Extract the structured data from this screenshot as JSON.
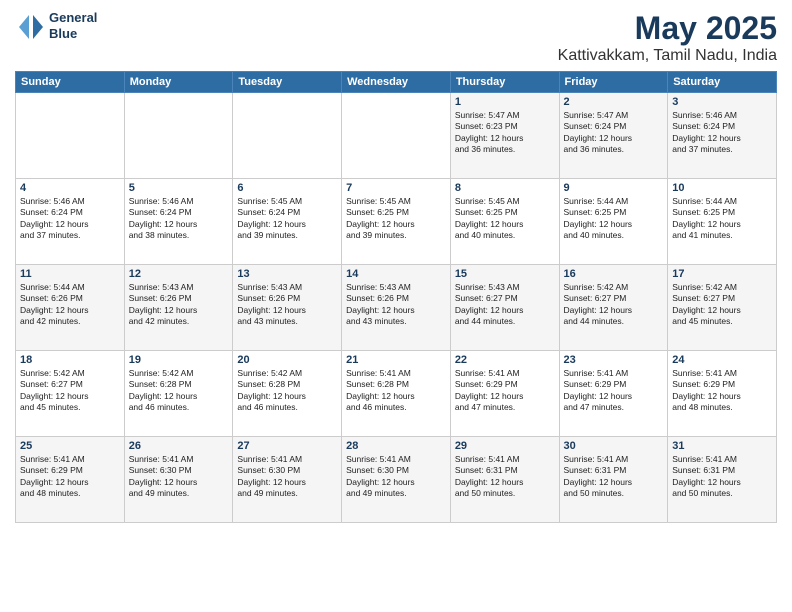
{
  "logo": {
    "line1": "General",
    "line2": "Blue"
  },
  "title": "May 2025",
  "location": "Kattivakkam, Tamil Nadu, India",
  "days_of_week": [
    "Sunday",
    "Monday",
    "Tuesday",
    "Wednesday",
    "Thursday",
    "Friday",
    "Saturday"
  ],
  "weeks": [
    [
      {
        "day": "",
        "text": ""
      },
      {
        "day": "",
        "text": ""
      },
      {
        "day": "",
        "text": ""
      },
      {
        "day": "",
        "text": ""
      },
      {
        "day": "1",
        "text": "Sunrise: 5:47 AM\nSunset: 6:23 PM\nDaylight: 12 hours\nand 36 minutes."
      },
      {
        "day": "2",
        "text": "Sunrise: 5:47 AM\nSunset: 6:24 PM\nDaylight: 12 hours\nand 36 minutes."
      },
      {
        "day": "3",
        "text": "Sunrise: 5:46 AM\nSunset: 6:24 PM\nDaylight: 12 hours\nand 37 minutes."
      }
    ],
    [
      {
        "day": "4",
        "text": "Sunrise: 5:46 AM\nSunset: 6:24 PM\nDaylight: 12 hours\nand 37 minutes."
      },
      {
        "day": "5",
        "text": "Sunrise: 5:46 AM\nSunset: 6:24 PM\nDaylight: 12 hours\nand 38 minutes."
      },
      {
        "day": "6",
        "text": "Sunrise: 5:45 AM\nSunset: 6:24 PM\nDaylight: 12 hours\nand 39 minutes."
      },
      {
        "day": "7",
        "text": "Sunrise: 5:45 AM\nSunset: 6:25 PM\nDaylight: 12 hours\nand 39 minutes."
      },
      {
        "day": "8",
        "text": "Sunrise: 5:45 AM\nSunset: 6:25 PM\nDaylight: 12 hours\nand 40 minutes."
      },
      {
        "day": "9",
        "text": "Sunrise: 5:44 AM\nSunset: 6:25 PM\nDaylight: 12 hours\nand 40 minutes."
      },
      {
        "day": "10",
        "text": "Sunrise: 5:44 AM\nSunset: 6:25 PM\nDaylight: 12 hours\nand 41 minutes."
      }
    ],
    [
      {
        "day": "11",
        "text": "Sunrise: 5:44 AM\nSunset: 6:26 PM\nDaylight: 12 hours\nand 42 minutes."
      },
      {
        "day": "12",
        "text": "Sunrise: 5:43 AM\nSunset: 6:26 PM\nDaylight: 12 hours\nand 42 minutes."
      },
      {
        "day": "13",
        "text": "Sunrise: 5:43 AM\nSunset: 6:26 PM\nDaylight: 12 hours\nand 43 minutes."
      },
      {
        "day": "14",
        "text": "Sunrise: 5:43 AM\nSunset: 6:26 PM\nDaylight: 12 hours\nand 43 minutes."
      },
      {
        "day": "15",
        "text": "Sunrise: 5:43 AM\nSunset: 6:27 PM\nDaylight: 12 hours\nand 44 minutes."
      },
      {
        "day": "16",
        "text": "Sunrise: 5:42 AM\nSunset: 6:27 PM\nDaylight: 12 hours\nand 44 minutes."
      },
      {
        "day": "17",
        "text": "Sunrise: 5:42 AM\nSunset: 6:27 PM\nDaylight: 12 hours\nand 45 minutes."
      }
    ],
    [
      {
        "day": "18",
        "text": "Sunrise: 5:42 AM\nSunset: 6:27 PM\nDaylight: 12 hours\nand 45 minutes."
      },
      {
        "day": "19",
        "text": "Sunrise: 5:42 AM\nSunset: 6:28 PM\nDaylight: 12 hours\nand 46 minutes."
      },
      {
        "day": "20",
        "text": "Sunrise: 5:42 AM\nSunset: 6:28 PM\nDaylight: 12 hours\nand 46 minutes."
      },
      {
        "day": "21",
        "text": "Sunrise: 5:41 AM\nSunset: 6:28 PM\nDaylight: 12 hours\nand 46 minutes."
      },
      {
        "day": "22",
        "text": "Sunrise: 5:41 AM\nSunset: 6:29 PM\nDaylight: 12 hours\nand 47 minutes."
      },
      {
        "day": "23",
        "text": "Sunrise: 5:41 AM\nSunset: 6:29 PM\nDaylight: 12 hours\nand 47 minutes."
      },
      {
        "day": "24",
        "text": "Sunrise: 5:41 AM\nSunset: 6:29 PM\nDaylight: 12 hours\nand 48 minutes."
      }
    ],
    [
      {
        "day": "25",
        "text": "Sunrise: 5:41 AM\nSunset: 6:29 PM\nDaylight: 12 hours\nand 48 minutes."
      },
      {
        "day": "26",
        "text": "Sunrise: 5:41 AM\nSunset: 6:30 PM\nDaylight: 12 hours\nand 49 minutes."
      },
      {
        "day": "27",
        "text": "Sunrise: 5:41 AM\nSunset: 6:30 PM\nDaylight: 12 hours\nand 49 minutes."
      },
      {
        "day": "28",
        "text": "Sunrise: 5:41 AM\nSunset: 6:30 PM\nDaylight: 12 hours\nand 49 minutes."
      },
      {
        "day": "29",
        "text": "Sunrise: 5:41 AM\nSunset: 6:31 PM\nDaylight: 12 hours\nand 50 minutes."
      },
      {
        "day": "30",
        "text": "Sunrise: 5:41 AM\nSunset: 6:31 PM\nDaylight: 12 hours\nand 50 minutes."
      },
      {
        "day": "31",
        "text": "Sunrise: 5:41 AM\nSunset: 6:31 PM\nDaylight: 12 hours\nand 50 minutes."
      }
    ]
  ]
}
